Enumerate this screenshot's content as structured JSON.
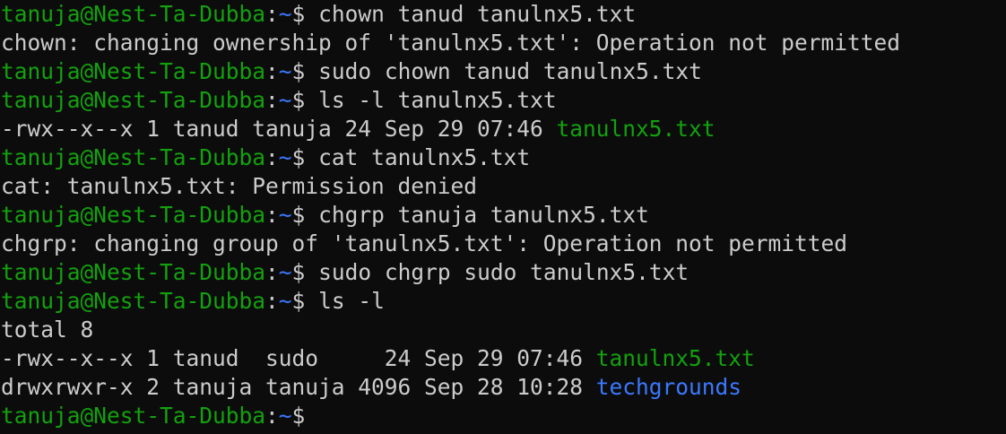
{
  "colors": {
    "background": "#0c0c0c",
    "text": "#cccccc",
    "prompt_user": "#13a10e",
    "prompt_path": "#3b78ff",
    "executable_file": "#13a10e",
    "directory": "#3b78ff"
  },
  "prompt": {
    "user_host": "tanuja@Nest-Ta-Dubba",
    "colon": ":",
    "path": "~",
    "dollar": "$ "
  },
  "lines": [
    {
      "type": "cmd",
      "text": "chown tanud tanulnx5.txt"
    },
    {
      "type": "out",
      "text": "chown: changing ownership of 'tanulnx5.txt': Operation not permitted"
    },
    {
      "type": "cmd",
      "text": "sudo chown tanud tanulnx5.txt"
    },
    {
      "type": "cmd",
      "text": "ls -l tanulnx5.txt"
    },
    {
      "type": "ls",
      "prefix": "-rwx--x--x 1 tanud tanuja 24 Sep 29 07:46 ",
      "name": "tanulnx5.txt",
      "kind": "exec"
    },
    {
      "type": "cmd",
      "text": "cat tanulnx5.txt"
    },
    {
      "type": "out",
      "text": "cat: tanulnx5.txt: Permission denied"
    },
    {
      "type": "cmd",
      "text": "chgrp tanuja tanulnx5.txt"
    },
    {
      "type": "out",
      "text": "chgrp: changing group of 'tanulnx5.txt': Operation not permitted"
    },
    {
      "type": "cmd",
      "text": "sudo chgrp sudo tanulnx5.txt"
    },
    {
      "type": "cmd",
      "text": "ls -l"
    },
    {
      "type": "out",
      "text": "total 8"
    },
    {
      "type": "ls",
      "prefix": "-rwx--x--x 1 tanud  sudo     24 Sep 29 07:46 ",
      "name": "tanulnx5.txt",
      "kind": "exec"
    },
    {
      "type": "ls",
      "prefix": "drwxrwxr-x 2 tanuja tanuja 4096 Sep 28 10:28 ",
      "name": "techgrounds",
      "kind": "dir"
    },
    {
      "type": "cmd",
      "text": ""
    }
  ]
}
